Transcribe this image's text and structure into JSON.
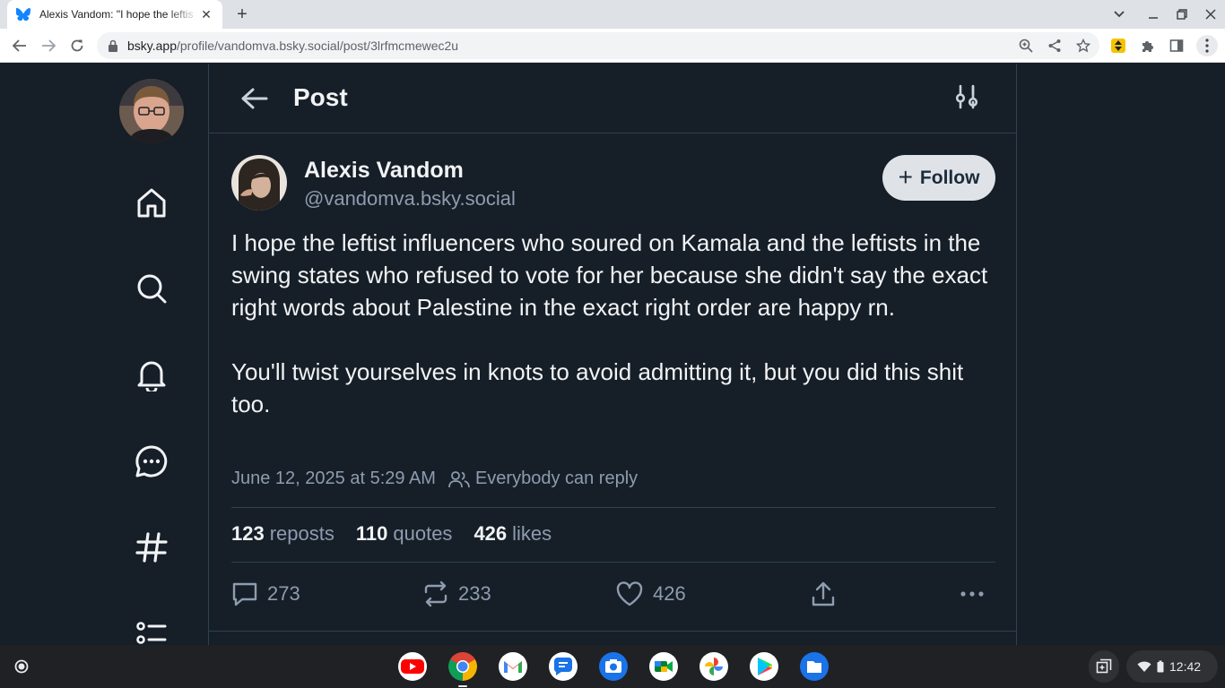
{
  "browser": {
    "tab_title": "Alexis Vandom: \"I hope the leftis",
    "url_domain": "bsky.app",
    "url_path": "/profile/vandomva.bsky.social/post/3lrfmcmewec2u"
  },
  "header": {
    "title": "Post"
  },
  "nav": {
    "items": [
      "home-icon",
      "search-icon",
      "bell-icon",
      "chat-icon",
      "hashtag-icon",
      "lists-icon"
    ]
  },
  "post": {
    "author_name": "Alexis Vandom",
    "author_handle": "@vandomva.bsky.social",
    "follow_label": "Follow",
    "paragraph_1": "I hope the leftist influencers who soured on Kamala and the leftists in the swing states who refused to vote for her because she didn't say the exact right words about Palestine in the exact right order are happy rn.",
    "paragraph_2": "You'll twist yourselves in knots to avoid admitting it, but you did this shit too.",
    "timestamp": "June 12, 2025 at 5:29 AM",
    "reply_setting": "Everybody can reply"
  },
  "stats": {
    "reposts_count": "123",
    "reposts_label": "reposts",
    "quotes_count": "110",
    "quotes_label": "quotes",
    "likes_count": "426",
    "likes_label": "likes"
  },
  "actions": {
    "replies": "273",
    "reposts": "233",
    "likes": "426"
  },
  "shelf": {
    "apps": [
      "YouTube",
      "Chrome",
      "Gmail",
      "Messages",
      "Camera",
      "Meet",
      "Photos",
      "Play Store",
      "Files"
    ],
    "time": "12:42"
  },
  "colors": {
    "background": "#161e27",
    "border": "#2e4052",
    "text_primary": "#f1f3f5",
    "text_secondary": "#8d9cb0",
    "follow_bg": "#dfe3e8"
  }
}
